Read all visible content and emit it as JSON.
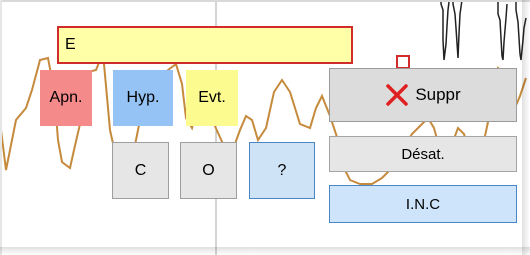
{
  "annotation_field": {
    "value": "E"
  },
  "event_buttons": {
    "apnea": "Apn.",
    "hypopnea": "Hyp.",
    "event": "Evt."
  },
  "type_buttons": {
    "central": "C",
    "obstructive": "O",
    "unknown": "?"
  },
  "actions": {
    "delete": "Suppr",
    "desat": "Désat.",
    "inc": "I.N.C"
  },
  "colors": {
    "trace": "#c58a3c",
    "apnea": "#f58a8a",
    "hypopnea": "#95c3f5",
    "event": "#fbfb90",
    "field_border": "#d12b2b",
    "field_bg": "#ffffa8",
    "delete_x": "#e02020"
  },
  "icons": {
    "delete": "red-x-icon",
    "swatch_top": "red-outline-square-icon",
    "swatch_bottom": "blue-square-icon"
  }
}
